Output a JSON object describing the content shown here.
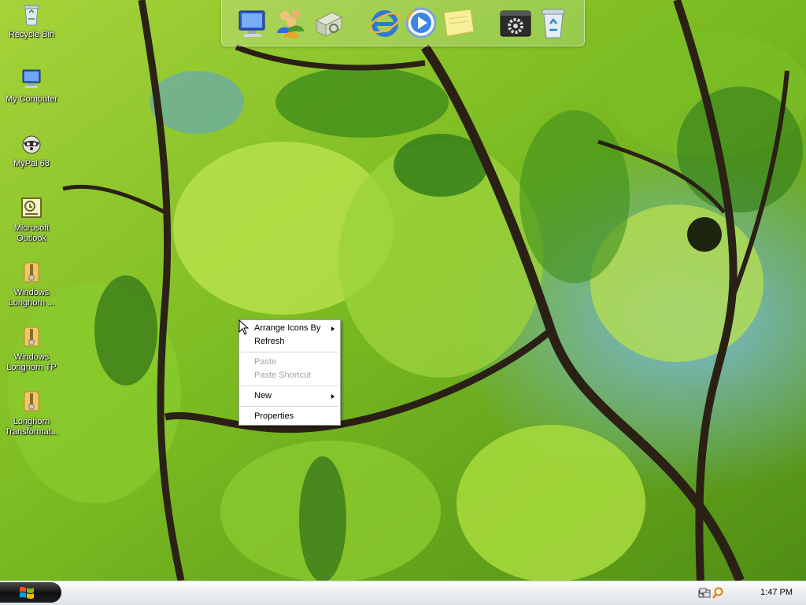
{
  "desktop": {
    "icons": [
      {
        "label": "Recycle Bin",
        "icon": "recycle-bin-icon"
      },
      {
        "label": "My Computer",
        "icon": "my-computer-icon"
      },
      {
        "label": "MyPal 68",
        "icon": "mypal-icon"
      },
      {
        "label": "Microsoft\nOutlook",
        "icon": "outlook-icon"
      },
      {
        "label": "Windows\nLonghorn ...",
        "icon": "zip-folder-icon"
      },
      {
        "label": "Windows\nLonghorn TP",
        "icon": "zip-folder-icon"
      },
      {
        "label": "Longhorn\nTransformat...",
        "icon": "zip-folder-icon"
      }
    ]
  },
  "dock": {
    "items": [
      {
        "icon": "computer-icon"
      },
      {
        "icon": "users-icon"
      },
      {
        "icon": "network-icon"
      },
      {
        "icon": "internet-explorer-icon"
      },
      {
        "icon": "media-player-icon"
      },
      {
        "icon": "sticky-note-icon"
      },
      {
        "icon": "settings-icon"
      },
      {
        "icon": "recycle-bin-icon"
      }
    ]
  },
  "context_menu": {
    "items": [
      {
        "label": "Arrange Icons By",
        "submenu": true,
        "enabled": true
      },
      {
        "label": "Refresh",
        "submenu": false,
        "enabled": true
      },
      {
        "label": "Paste",
        "submenu": false,
        "enabled": false
      },
      {
        "label": "Paste Shortcut",
        "submenu": false,
        "enabled": false
      },
      {
        "label": "New",
        "submenu": true,
        "enabled": true
      },
      {
        "label": "Properties",
        "submenu": false,
        "enabled": true
      }
    ]
  },
  "taskbar": {
    "start_icon": "windows-logo-icon",
    "tray_icons": [
      "keyboard-icon",
      "network-icon",
      "search-icon"
    ],
    "clock": "1:47 PM"
  },
  "colors": {
    "taskbar_bg": "#e9ecef",
    "start_button": "#1a1a1a",
    "menu_disabled": "#a4a4a4",
    "desktop_label": "#ffffff"
  }
}
